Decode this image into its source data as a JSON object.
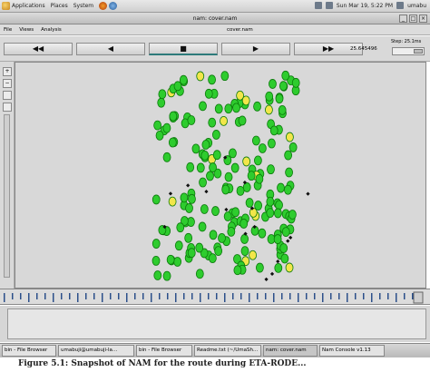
{
  "top_panel": {
    "menus": [
      "Applications",
      "Places",
      "System"
    ],
    "clock": "Sun Mar 19, 5:22 PM",
    "user": "umabu"
  },
  "window": {
    "title": "nam: cover.nam"
  },
  "menubar": {
    "items": [
      "File",
      "Views",
      "Analysis"
    ],
    "file_label": "cover.nam"
  },
  "transport": {
    "rewind": "◀◀",
    "back": "◀",
    "stop": "■",
    "play": "▶",
    "fast_forward": "▶▶",
    "time": "25.645496",
    "step": "Step: 25.1ms"
  },
  "tools": [
    "+",
    "−",
    "",
    ""
  ],
  "colors": {
    "node_fill": "#2ecc2e",
    "node_ring": "#0b7a0b",
    "highlight": "#f2e64a",
    "packet": "#111111",
    "canvas_bg": "#d8d8d8"
  },
  "taskbar": {
    "items": [
      "bin - File Browser",
      "umabuji@umabuji-la...",
      "bin - File Browser",
      "Readme.txt (~/UmaSh...",
      "nam: cover.nam",
      "Nam Console v1.13"
    ]
  },
  "caption": "Figure 5.1: Snapshot of NAM for the route during ETA-RODE..."
}
